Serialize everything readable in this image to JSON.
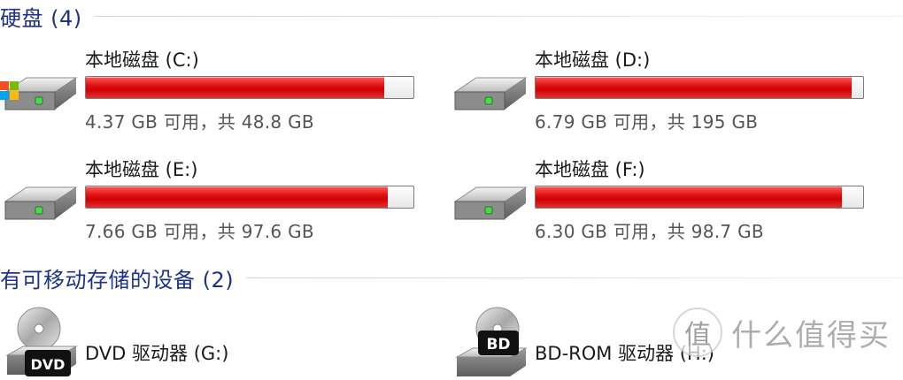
{
  "sections": {
    "hard_drives": {
      "title": "硬盘 (4)"
    },
    "removable": {
      "title": "有可移动存储的设备 (2)"
    }
  },
  "drives": [
    {
      "name": "本地磁盘 (C:)",
      "free_text": "4.37 GB 可用，共 48.8 GB",
      "used_fraction": 0.91,
      "icon": "windows-hard-drive-icon"
    },
    {
      "name": "本地磁盘 (D:)",
      "free_text": "6.79 GB 可用，共 195 GB",
      "used_fraction": 0.965,
      "icon": "hard-drive-icon"
    },
    {
      "name": "本地磁盘 (E:)",
      "free_text": "7.66 GB 可用，共 97.6 GB",
      "used_fraction": 0.922,
      "icon": "hard-drive-icon"
    },
    {
      "name": "本地磁盘 (F:)",
      "free_text": "6.30 GB 可用，共 98.7 GB",
      "used_fraction": 0.936,
      "icon": "hard-drive-icon"
    }
  ],
  "removable_devices": [
    {
      "name": "DVD 驱动器 (G:)",
      "badge": "DVD",
      "icon": "dvd-drive-icon"
    },
    {
      "name": "BD-ROM 驱动器 (H:)",
      "badge": "BD",
      "icon": "bd-rom-drive-icon"
    }
  ],
  "watermark": {
    "text": "什么值得买",
    "badge": "值"
  },
  "colors": {
    "bar_fill": "#d10000",
    "section_title": "#1e3287",
    "secondary_text": "#555555"
  }
}
